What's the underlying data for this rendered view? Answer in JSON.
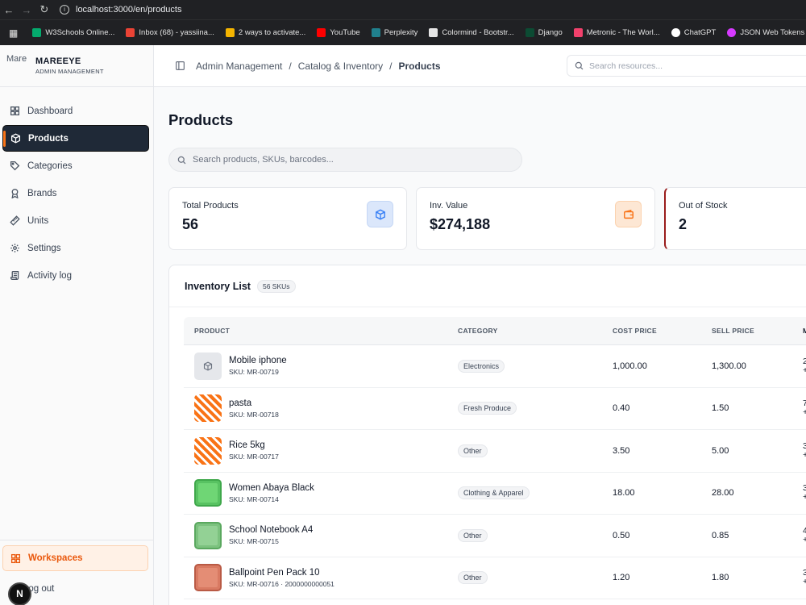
{
  "browser": {
    "url": "localhost:3000/en/products",
    "bookmarks": [
      {
        "label": "W3Schools Online...",
        "color": "#04aa6d"
      },
      {
        "label": "Inbox (68) - yassiina...",
        "color": "#ea4335"
      },
      {
        "label": "2 ways to activate...",
        "color": "#f4b400"
      },
      {
        "label": "YouTube",
        "color": "#ff0000"
      },
      {
        "label": "Perplexity",
        "color": "#20808d"
      },
      {
        "label": "Colormind - Bootstr...",
        "color": "#e5e5e5"
      },
      {
        "label": "Django",
        "color": "#0c4b33"
      },
      {
        "label": "Metronic - The Worl...",
        "color": "#f1416c"
      },
      {
        "label": "ChatGPT",
        "color": "#ffffff"
      },
      {
        "label": "JSON Web Tokens -...",
        "color": "#d63aff"
      }
    ]
  },
  "sidebar": {
    "brand_image_alt": "Mare",
    "brand_name": "MAREEYE",
    "brand_sub": "ADMIN MANAGEMENT",
    "items": [
      {
        "label": "Dashboard",
        "icon": "dashboard-icon"
      },
      {
        "label": "Products",
        "icon": "box-icon",
        "active": true
      },
      {
        "label": "Categories",
        "icon": "tag-icon"
      },
      {
        "label": "Brands",
        "icon": "award-icon"
      },
      {
        "label": "Units",
        "icon": "ruler-icon"
      },
      {
        "label": "Settings",
        "icon": "gear-icon"
      },
      {
        "label": "Activity log",
        "icon": "scroll-icon"
      }
    ],
    "workspaces_label": "Workspaces",
    "logout_label": "Log out",
    "badge_letter": "N"
  },
  "header": {
    "breadcrumb": [
      "Admin Management",
      "Catalog & Inventory",
      "Products"
    ],
    "search_placeholder": "Search resources..."
  },
  "page": {
    "title": "Products",
    "search_placeholder": "Search products, SKUs, barcodes..."
  },
  "stats": [
    {
      "label": "Total Products",
      "value": "56",
      "icon": "box-icon",
      "accent": "#3b82f6"
    },
    {
      "label": "Inv. Value",
      "value": "$274,188",
      "icon": "wallet-icon",
      "accent": "#f97316"
    },
    {
      "label": "Out of Stock",
      "value": "2",
      "accent": "#991b1b"
    }
  ],
  "inventory": {
    "title": "Inventory List",
    "badge": "56 SKUs",
    "columns": [
      "PRODUCT",
      "CATEGORY",
      "COST PRICE",
      "SELL PRICE",
      "M"
    ],
    "rows": [
      {
        "name": "Mobile iphone",
        "sku": "SKU: MR-00719",
        "category": "Electronics",
        "cost": "1,000.00",
        "sell": "1,300.00",
        "m1": "2",
        "m2": "+",
        "thumb": "box"
      },
      {
        "name": "pasta",
        "sku": "SKU: MR-00718",
        "category": "Fresh Produce",
        "cost": "0.40",
        "sell": "1.50",
        "m1": "7",
        "m2": "+",
        "thumb": "pattern"
      },
      {
        "name": "Rice 5kg",
        "sku": "SKU: MR-00717",
        "category": "Other",
        "cost": "3.50",
        "sell": "5.00",
        "m1": "3",
        "m2": "+",
        "thumb": "pattern"
      },
      {
        "name": "Women Abaya Black",
        "sku": "SKU: MR-00714",
        "category": "Clothing & Apparel",
        "cost": "18.00",
        "sell": "28.00",
        "m1": "3",
        "m2": "+",
        "thumb": "green"
      },
      {
        "name": "School Notebook A4",
        "sku": "SKU: MR-00715",
        "category": "Other",
        "cost": "0.50",
        "sell": "0.85",
        "m1": "4",
        "m2": "+",
        "thumb": "lightgreen"
      },
      {
        "name": "Ballpoint Pen Pack 10",
        "sku": "SKU: MR-00716 · 2000000000051",
        "category": "Other",
        "cost": "1.20",
        "sell": "1.80",
        "m1": "3",
        "m2": "+",
        "thumb": "salmon"
      }
    ]
  }
}
